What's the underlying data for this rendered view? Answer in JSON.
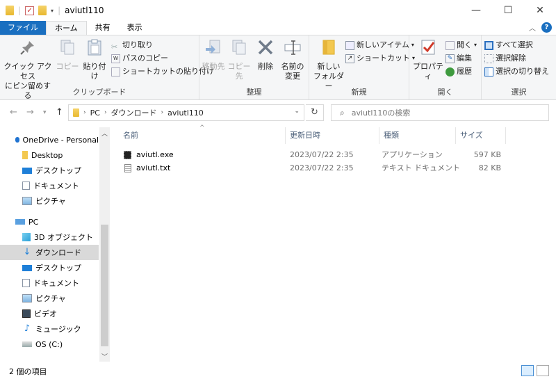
{
  "window": {
    "title": "aviutl110",
    "controls": [
      "—",
      "☐",
      "✕"
    ]
  },
  "ribbon_tabs": {
    "file": "ファイル",
    "home": "ホーム",
    "share": "共有",
    "view": "表示"
  },
  "ribbon": {
    "clipboard": {
      "label": "クリップボード",
      "pin": "クイック アクセス\nにピン留めする",
      "pin_line1": "クイック アクセス",
      "pin_line2": "にピン留めする",
      "copy": "コピー",
      "paste": "貼り付け",
      "cut": "切り取り",
      "copy_path": "パスのコピー",
      "paste_shortcut": "ショートカットの貼り付け"
    },
    "organize": {
      "label": "整理",
      "move_to": "移動先",
      "copy_to": "コピー先",
      "delete": "削除",
      "rename_line1": "名前の",
      "rename_line2": "変更"
    },
    "new": {
      "label": "新規",
      "new_folder_line1": "新しい",
      "new_folder_line2": "フォルダー",
      "new_item": "新しいアイテム",
      "shortcut": "ショートカット"
    },
    "open": {
      "label": "開く",
      "properties": "プロパティ",
      "open": "開く",
      "edit": "編集",
      "history": "履歴"
    },
    "select": {
      "label": "選択",
      "select_all": "すべて選択",
      "select_none": "選択解除",
      "invert": "選択の切り替え"
    }
  },
  "address": {
    "segments": [
      "PC",
      "ダウンロード",
      "aviutl110"
    ],
    "search_placeholder": "aviutl110の検索"
  },
  "nav": {
    "items": [
      {
        "label": "OneDrive - Personal",
        "icon": "cloud-icon"
      },
      {
        "label": "Desktop",
        "icon": "folder-icon"
      },
      {
        "label": "デスクトップ",
        "icon": "desktop-icon"
      },
      {
        "label": "ドキュメント",
        "icon": "document-icon"
      },
      {
        "label": "ピクチャ",
        "icon": "picture-icon"
      },
      {
        "label": "PC",
        "icon": "pc-icon"
      },
      {
        "label": "3D オブジェクト",
        "icon": "cube-icon"
      },
      {
        "label": "ダウンロード",
        "icon": "download-icon"
      },
      {
        "label": "デスクトップ",
        "icon": "desktop-icon"
      },
      {
        "label": "ドキュメント",
        "icon": "document-icon"
      },
      {
        "label": "ピクチャ",
        "icon": "picture-icon"
      },
      {
        "label": "ビデオ",
        "icon": "video-icon"
      },
      {
        "label": "ミュージック",
        "icon": "music-icon"
      },
      {
        "label": "OS (C:)",
        "icon": "drive-icon"
      }
    ]
  },
  "columns": {
    "name": "名前",
    "modified": "更新日時",
    "type": "種類",
    "size": "サイズ"
  },
  "files": [
    {
      "name": "aviutl.exe",
      "modified": "2023/07/22 2:35",
      "type": "アプリケーション",
      "size": "597 KB",
      "icon": "exe-icon"
    },
    {
      "name": "aviutl.txt",
      "modified": "2023/07/22 2:35",
      "type": "テキスト ドキュメント",
      "size": "82 KB",
      "icon": "text-file-icon"
    }
  ],
  "status": {
    "item_count": "2 個の項目"
  }
}
